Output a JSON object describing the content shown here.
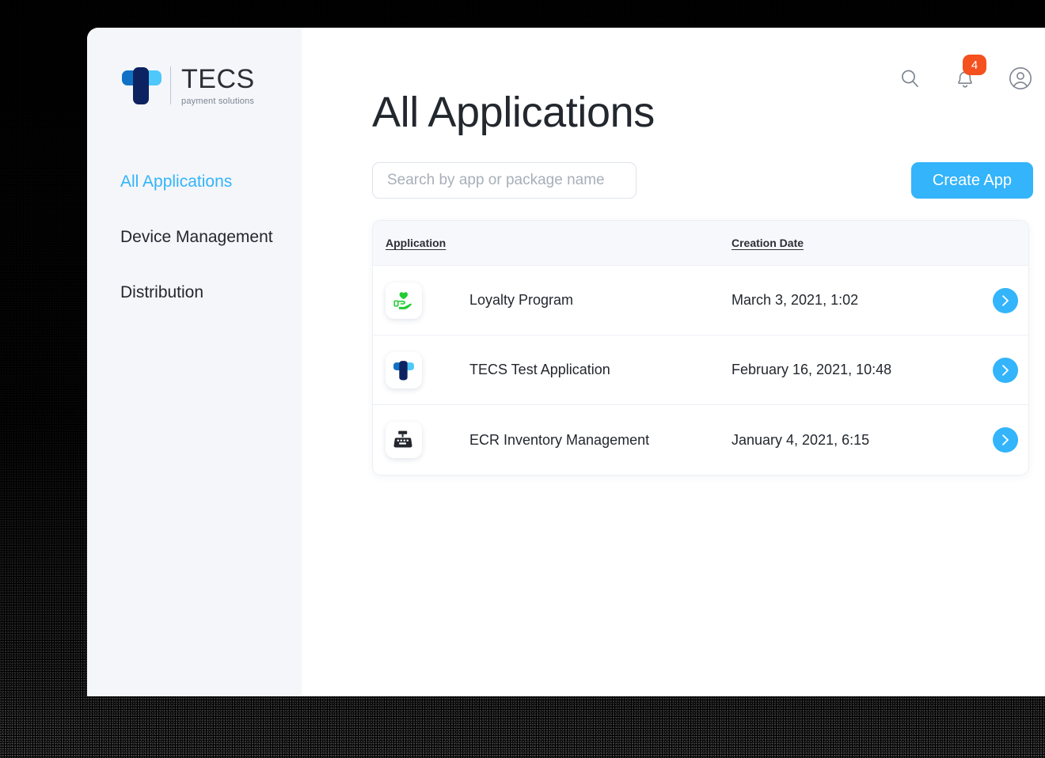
{
  "brand": {
    "name": "TECS",
    "tagline": "payment solutions",
    "logo_icon": "tecs-t-logo-icon"
  },
  "sidebar": {
    "items": [
      {
        "label": "All Applications",
        "active": true
      },
      {
        "label": "Device Management",
        "active": false
      },
      {
        "label": "Distribution",
        "active": false
      }
    ]
  },
  "header": {
    "title": "All Applications",
    "icons": {
      "search": "search-icon",
      "notifications": "bell-icon",
      "account": "user-circle-icon"
    },
    "notification_count": "4"
  },
  "search": {
    "value": "",
    "placeholder": "Search by app or package name"
  },
  "toolbar": {
    "create_app_label": "Create App"
  },
  "table": {
    "columns": {
      "application": "Application",
      "creation_date": "Creation Date"
    },
    "rows": [
      {
        "name": "Loyalty Program",
        "date": "March 3, 2021, 1:02",
        "icon": "hand-holding-heart-icon",
        "action": "chevron-right-icon"
      },
      {
        "name": "TECS Test Application",
        "date": "February 16, 2021, 10:48",
        "icon": "tecs-t-logo-icon",
        "action": "chevron-right-icon"
      },
      {
        "name": "ECR Inventory Management",
        "date": "January 4, 2021, 6:15",
        "icon": "cash-register-icon",
        "action": "chevron-right-icon"
      }
    ]
  },
  "colors": {
    "accent": "#33b4fb",
    "badge": "#f4511e",
    "sidebar_bg": "#f5f6fa",
    "text": "#23272e",
    "logo_dark": "#0d2361",
    "logo_mid": "#1171c4",
    "logo_light": "#4ec8fb",
    "loyalty_green": "#22cc33",
    "ecr_dark": "#24262d"
  }
}
